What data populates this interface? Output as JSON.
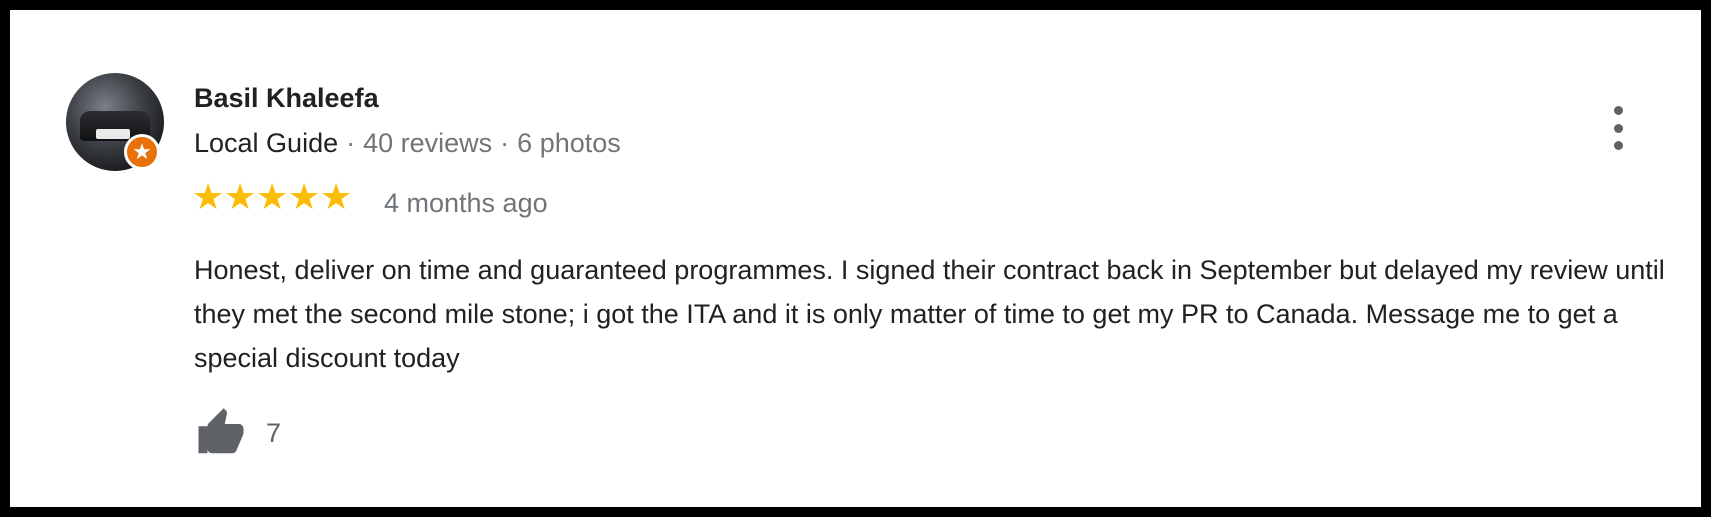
{
  "review": {
    "author": "Basil Khaleefa",
    "role": "Local Guide",
    "reviews_count": "40 reviews",
    "photos_count": "6 photos",
    "rating": 5,
    "time": "4 months ago",
    "text": "Honest, deliver on time and guaranteed programmes. I signed their contract back in September but delayed my review until they met the second mile stone; i got the ITA and it is only matter of time to get my PR to Canada. Message me to get a special discount today",
    "likes": "7"
  },
  "icons": {
    "more": "more-vert-icon",
    "badge": "local-guide-star-icon",
    "like": "thumbs-up-icon",
    "star": "star-icon"
  },
  "colors": {
    "star": "#fbbc04",
    "badge": "#e8710a",
    "muted": "#70757a"
  }
}
